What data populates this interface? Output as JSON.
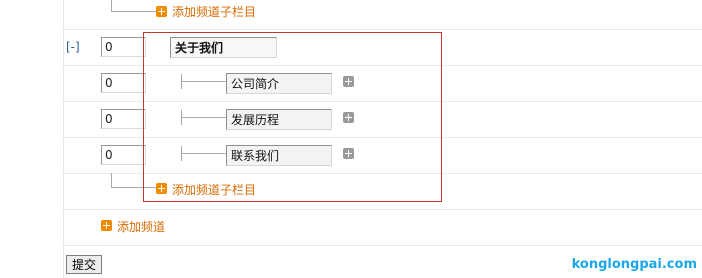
{
  "add_subcategory_label": "添加频道子栏目",
  "add_channel_label": "添加频道",
  "channel": {
    "toggle": "[-]",
    "sort": "0",
    "name": "关于我们",
    "children": [
      {
        "sort": "0",
        "name": "公司简介"
      },
      {
        "sort": "0",
        "name": "发展历程"
      },
      {
        "sort": "0",
        "name": "联系我们"
      }
    ]
  },
  "submit_label": "提交",
  "watermark": "konglongpai.com",
  "colors": {
    "link_orange": "#d86a00",
    "plus_orange": "#f08a00",
    "plus_gray": "#9a9a9a",
    "highlight_red": "#c0392b",
    "toggle_blue": "#2a5fa6",
    "watermark_blue": "#1aa7e8"
  }
}
